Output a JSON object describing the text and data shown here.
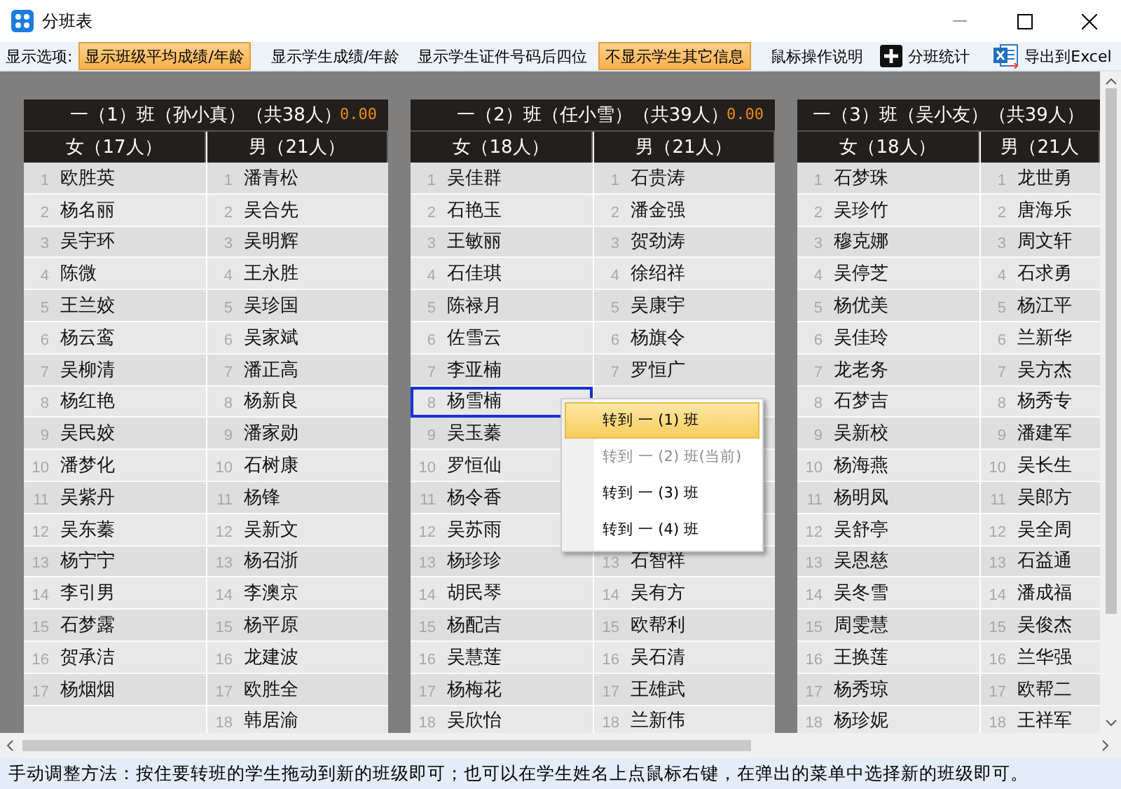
{
  "window": {
    "title": "分班表"
  },
  "toolbar": {
    "label": "显示选项:",
    "options": [
      {
        "label": "显示班级平均成绩/年龄",
        "on": true
      },
      {
        "label": "显示学生成绩/年龄",
        "on": false
      },
      {
        "label": "显示学生证件号码后四位",
        "on": false
      },
      {
        "label": "不显示学生其它信息",
        "on": true
      },
      {
        "label": "鼠标操作说明",
        "on": false
      }
    ],
    "actions": [
      {
        "label": "分班统计",
        "kind": "plus"
      },
      {
        "label": "导出到Excel",
        "kind": "excel"
      }
    ]
  },
  "classes": [
    {
      "title": "一（1）班（孙小真）（共38人）",
      "score": "0.00",
      "groups": [
        {
          "heading": "女（17人）",
          "students": [
            {
              "no": "1",
              "name": "欧胜英",
              "selected": false
            },
            {
              "no": "2",
              "name": "杨名丽",
              "selected": false
            },
            {
              "no": "3",
              "name": "吴宇环",
              "selected": false
            },
            {
              "no": "4",
              "name": "陈微",
              "selected": false
            },
            {
              "no": "5",
              "name": "王兰姣",
              "selected": false
            },
            {
              "no": "6",
              "name": "杨云鸾",
              "selected": false
            },
            {
              "no": "7",
              "name": "吴柳清",
              "selected": false
            },
            {
              "no": "8",
              "name": "杨红艳",
              "selected": false
            },
            {
              "no": "9",
              "name": "吴民姣",
              "selected": false
            },
            {
              "no": "10",
              "name": "潘梦化",
              "selected": false
            },
            {
              "no": "11",
              "name": "吴紫丹",
              "selected": false
            },
            {
              "no": "12",
              "name": "吴东蓁",
              "selected": false
            },
            {
              "no": "13",
              "name": "杨宁宁",
              "selected": false
            },
            {
              "no": "14",
              "name": "李引男",
              "selected": false
            },
            {
              "no": "15",
              "name": "石梦露",
              "selected": false
            },
            {
              "no": "16",
              "name": "贺承洁",
              "selected": false
            },
            {
              "no": "17",
              "name": "杨烟烟",
              "selected": false
            }
          ]
        },
        {
          "heading": "男（21人）",
          "students": [
            {
              "no": "1",
              "name": "潘青松",
              "selected": false
            },
            {
              "no": "2",
              "name": "吴合先",
              "selected": false
            },
            {
              "no": "3",
              "name": "吴明辉",
              "selected": false
            },
            {
              "no": "4",
              "name": "王永胜",
              "selected": false
            },
            {
              "no": "5",
              "name": "吴珍国",
              "selected": false
            },
            {
              "no": "6",
              "name": "吴家斌",
              "selected": false
            },
            {
              "no": "7",
              "name": "潘正高",
              "selected": false
            },
            {
              "no": "8",
              "name": "杨新良",
              "selected": false
            },
            {
              "no": "9",
              "name": "潘家勋",
              "selected": false
            },
            {
              "no": "10",
              "name": "石树康",
              "selected": false
            },
            {
              "no": "11",
              "name": "杨锋",
              "selected": false
            },
            {
              "no": "12",
              "name": "吴新文",
              "selected": false
            },
            {
              "no": "13",
              "name": "杨召浙",
              "selected": false
            },
            {
              "no": "14",
              "name": "李澳京",
              "selected": false
            },
            {
              "no": "15",
              "name": "杨平原",
              "selected": false
            },
            {
              "no": "16",
              "name": "龙建波",
              "selected": false
            },
            {
              "no": "17",
              "name": "欧胜全",
              "selected": false
            },
            {
              "no": "18",
              "name": "韩居渝",
              "selected": false
            }
          ]
        }
      ]
    },
    {
      "title": "一（2）班（任小雪）（共39人）",
      "score": "0.00",
      "groups": [
        {
          "heading": "女（18人）",
          "students": [
            {
              "no": "1",
              "name": "吴佳群",
              "selected": false
            },
            {
              "no": "2",
              "name": "石艳玉",
              "selected": false
            },
            {
              "no": "3",
              "name": "王敏丽",
              "selected": false
            },
            {
              "no": "4",
              "name": "石佳琪",
              "selected": false
            },
            {
              "no": "5",
              "name": "陈禄月",
              "selected": false
            },
            {
              "no": "6",
              "name": "佐雪云",
              "selected": false
            },
            {
              "no": "7",
              "name": "李亚楠",
              "selected": false
            },
            {
              "no": "8",
              "name": "杨雪楠",
              "selected": true
            },
            {
              "no": "9",
              "name": "吴玉蓁",
              "selected": false
            },
            {
              "no": "10",
              "name": "罗恒仙",
              "selected": false
            },
            {
              "no": "11",
              "name": "杨令香",
              "selected": false
            },
            {
              "no": "12",
              "name": "吴苏雨",
              "selected": false
            },
            {
              "no": "13",
              "name": "杨珍珍",
              "selected": false
            },
            {
              "no": "14",
              "name": "胡民琴",
              "selected": false
            },
            {
              "no": "15",
              "name": "杨配吉",
              "selected": false
            },
            {
              "no": "16",
              "name": "吴慧莲",
              "selected": false
            },
            {
              "no": "17",
              "name": "杨梅花",
              "selected": false
            },
            {
              "no": "18",
              "name": "吴欣怡",
              "selected": false
            }
          ]
        },
        {
          "heading": "男（21人）",
          "students": [
            {
              "no": "1",
              "name": "石贵涛",
              "selected": false
            },
            {
              "no": "2",
              "name": "潘金强",
              "selected": false
            },
            {
              "no": "3",
              "name": "贺劲涛",
              "selected": false
            },
            {
              "no": "4",
              "name": "徐绍祥",
              "selected": false
            },
            {
              "no": "5",
              "name": "吴康宇",
              "selected": false
            },
            {
              "no": "6",
              "name": "杨旗令",
              "selected": false
            },
            {
              "no": "7",
              "name": "罗恒广",
              "selected": false
            },
            {
              "kind": "covered"
            },
            {
              "kind": "covered"
            },
            {
              "kind": "covered"
            },
            {
              "kind": "covered"
            },
            {
              "kind": "covered"
            },
            {
              "no": "13",
              "name": "石智祥",
              "selected": false
            },
            {
              "no": "14",
              "name": "吴有方",
              "selected": false
            },
            {
              "no": "15",
              "name": "欧帮利",
              "selected": false
            },
            {
              "no": "16",
              "name": "吴石清",
              "selected": false
            },
            {
              "no": "17",
              "name": "王雄武",
              "selected": false
            },
            {
              "no": "18",
              "name": "兰新伟",
              "selected": false
            }
          ]
        }
      ]
    },
    {
      "title": "一（3）班（吴小友）（共39人）",
      "groups": [
        {
          "heading": "女（18人）",
          "students": [
            {
              "no": "1",
              "name": "石梦珠",
              "selected": false
            },
            {
              "no": "2",
              "name": "吴珍竹",
              "selected": false
            },
            {
              "no": "3",
              "name": "穆克娜",
              "selected": false
            },
            {
              "no": "4",
              "name": "吴停芝",
              "selected": false
            },
            {
              "no": "5",
              "name": "杨优美",
              "selected": false
            },
            {
              "no": "6",
              "name": "吴佳玲",
              "selected": false
            },
            {
              "no": "7",
              "name": "龙老务",
              "selected": false
            },
            {
              "no": "8",
              "name": "石梦吉",
              "selected": false
            },
            {
              "no": "9",
              "name": "吴新校",
              "selected": false
            },
            {
              "no": "10",
              "name": "杨海燕",
              "selected": false
            },
            {
              "no": "11",
              "name": "杨明凤",
              "selected": false
            },
            {
              "no": "12",
              "name": "吴舒亭",
              "selected": false
            },
            {
              "no": "13",
              "name": "吴恩慈",
              "selected": false
            },
            {
              "no": "14",
              "name": "吴冬雪",
              "selected": false
            },
            {
              "no": "15",
              "name": "周雯慧",
              "selected": false
            },
            {
              "no": "16",
              "name": "王换莲",
              "selected": false
            },
            {
              "no": "17",
              "name": "杨秀琼",
              "selected": false
            },
            {
              "no": "18",
              "name": "杨珍妮",
              "selected": false
            }
          ]
        },
        {
          "heading": "男（21人",
          "students": [
            {
              "no": "1",
              "name": "龙世勇",
              "selected": false
            },
            {
              "no": "2",
              "name": "唐海乐",
              "selected": false
            },
            {
              "no": "3",
              "name": "周文轩",
              "selected": false
            },
            {
              "no": "4",
              "name": "石求勇",
              "selected": false
            },
            {
              "no": "5",
              "name": "杨江平",
              "selected": false
            },
            {
              "no": "6",
              "name": "兰新华",
              "selected": false
            },
            {
              "no": "7",
              "name": "吴方杰",
              "selected": false
            },
            {
              "no": "8",
              "name": "杨秀专",
              "selected": false
            },
            {
              "no": "9",
              "name": "潘建军",
              "selected": false
            },
            {
              "no": "10",
              "name": "吴长生",
              "selected": false
            },
            {
              "no": "11",
              "name": "吴郎方",
              "selected": false
            },
            {
              "no": "12",
              "name": "吴全周",
              "selected": false
            },
            {
              "no": "13",
              "name": "石益通",
              "selected": false
            },
            {
              "no": "14",
              "name": "潘成福",
              "selected": false
            },
            {
              "no": "15",
              "name": "吴俊杰",
              "selected": false
            },
            {
              "no": "16",
              "name": "兰华强",
              "selected": false
            },
            {
              "no": "17",
              "name": "欧帮二",
              "selected": false
            },
            {
              "no": "18",
              "name": "王祥军",
              "selected": false
            }
          ]
        }
      ]
    }
  ],
  "context_menu": {
    "items": [
      {
        "label": "转到 一 (1) 班",
        "selected": true,
        "disabled": false
      },
      {
        "label": "转到 一 (2) 班(当前)",
        "selected": false,
        "disabled": true
      },
      {
        "label": "转到 一 (3) 班",
        "selected": false,
        "disabled": false
      },
      {
        "label": "转到 一 (4) 班",
        "selected": false,
        "disabled": false
      }
    ]
  },
  "status_bar": {
    "text": "手动调整方法：按住要转班的学生拖动到新的班级即可；也可以在学生姓名上点鼠标右键，在弹出的菜单中选择新的班级即可。"
  }
}
